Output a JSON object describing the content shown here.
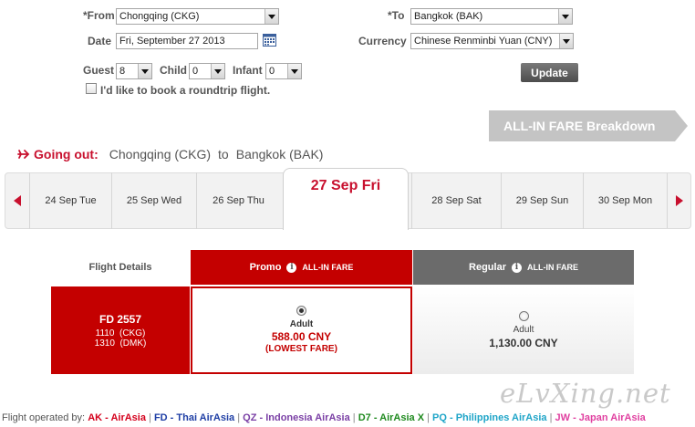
{
  "form": {
    "from_label": "*From",
    "from_value": "Chongqing (CKG)",
    "to_label": "*To",
    "to_value": "Bangkok (BAK)",
    "date_label": "Date",
    "date_value": "Fri, September 27 2013",
    "currency_label": "Currency",
    "currency_value": "Chinese Renminbi Yuan (CNY)",
    "guest_label": "Guest",
    "guest_value": "8",
    "child_label": "Child",
    "child_value": "0",
    "infant_label": "Infant",
    "infant_value": "0",
    "roundtrip_label": "I'd like to book a roundtrip flight.",
    "update_label": "Update"
  },
  "breakdown_label": "ALL-IN FARE Breakdown",
  "going_out": {
    "label": "Going out:",
    "origin": "Chongqing (CKG)",
    "to_word": "to",
    "destination": "Bangkok (BAK)"
  },
  "dates": [
    "24 Sep Tue",
    "25 Sep Wed",
    "26 Sep Thu",
    "27 Sep Fri",
    "28 Sep Sat",
    "29 Sep Sun",
    "30 Sep Mon"
  ],
  "selected_date": "27 Sep Fri",
  "table": {
    "flight_details_header": "Flight Details",
    "promo_header": "Promo",
    "regular_header": "Regular",
    "allin_tag": "ALL-IN FARE",
    "info_glyph": "i",
    "flight_number": "FD 2557",
    "depart": "1110  (CKG)",
    "arrive": "1310  (DMK)",
    "promo_pax": "Adult",
    "promo_price": "588.00 CNY",
    "promo_note": "(LOWEST FARE)",
    "regular_pax": "Adult",
    "regular_price": "1,130.00 CNY"
  },
  "watermark": "eLvXing.net",
  "footer": {
    "prefix": "Flight operated by:",
    "sep": "|",
    "carriers": [
      {
        "code": "AK - AirAsia",
        "color": "#d4001c"
      },
      {
        "code": "FD - Thai AirAsia",
        "color": "#1f3fa5"
      },
      {
        "code": "QZ - Indonesia AirAsia",
        "color": "#7a3fa5"
      },
      {
        "code": "D7 - AirAsia X",
        "color": "#1f8a1f"
      },
      {
        "code": "PQ - Philippines AirAsia",
        "color": "#1fa5c8"
      },
      {
        "code": "JW - Japan AirAsia",
        "color": "#e040a0"
      }
    ]
  },
  "colors": {
    "brand_red": "#c8102e",
    "panel_red": "#c40000",
    "regular_grey": "#6b6b6b"
  }
}
